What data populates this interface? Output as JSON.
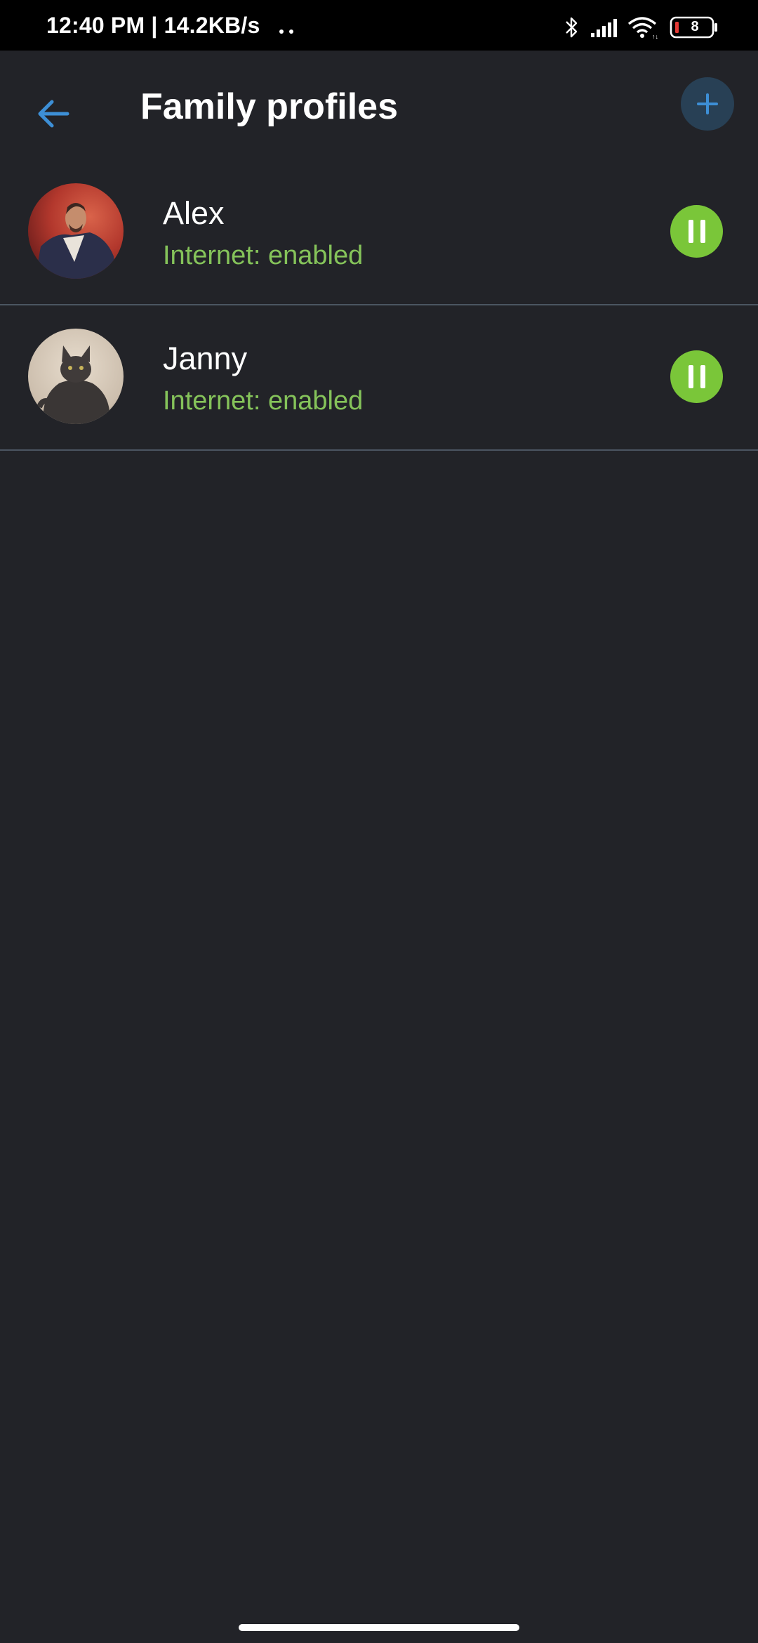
{
  "status_bar": {
    "time_speed": "12:40 PM | 14.2KB/s",
    "battery_level": "8",
    "battery_color": "#e53935",
    "icons": [
      "bluetooth-icon",
      "signal-icon",
      "wifi-icon",
      "battery-icon"
    ]
  },
  "app_bar": {
    "title": "Family profiles",
    "back_icon": "arrow-left-icon",
    "add_icon": "plus-icon",
    "accent_color": "#3d8fd6"
  },
  "profiles": [
    {
      "name": "Alex",
      "status": "Internet: enabled",
      "avatar": "photo-man-red-background",
      "action_icon": "pause-icon"
    },
    {
      "name": "Janny",
      "status": "Internet: enabled",
      "avatar": "photo-grey-cat",
      "action_icon": "pause-icon"
    }
  ],
  "colors": {
    "background": "#222328",
    "status_enabled": "#85c35a",
    "pause_button": "#7ac639",
    "divider": "#4b5561"
  }
}
